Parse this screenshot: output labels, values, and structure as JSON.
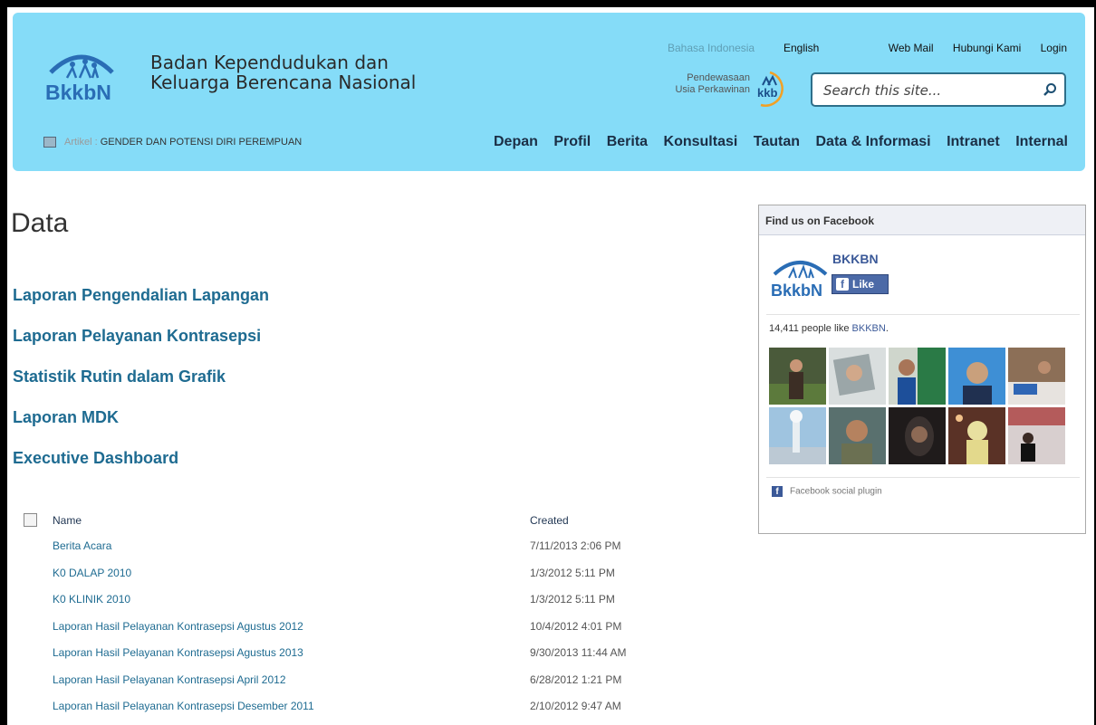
{
  "header": {
    "org_line1": "Badan Kependudukan dan",
    "org_line2": "Keluarga Berencana Nasional",
    "lang_id": "Bahasa Indonesia",
    "lang_en": "English",
    "top_links": [
      "Web Mail",
      "Hubungi Kami",
      "Login"
    ],
    "pendewasaan_line1": "Pendewasaan",
    "pendewasaan_line2": "Usia Perkawinan",
    "search_placeholder": "Search this site...",
    "article_prefix": "Artikel :",
    "article_title": "GENDER DAN POTENSI DIRI PEREMPUAN",
    "nav": [
      "Depan",
      "Profil",
      "Berita",
      "Konsultasi",
      "Tautan",
      "Data & Informasi",
      "Intranet",
      "Internal"
    ]
  },
  "main": {
    "title": "Data",
    "section_links": [
      "Laporan Pengendalian Lapangan",
      "Laporan Pelayanan Kontrasepsi",
      "Statistik Rutin dalam Grafik",
      "Laporan MDK",
      "Executive Dashboard"
    ],
    "list": {
      "col_name": "Name",
      "col_created": "Created",
      "rows": [
        {
          "name": "Berita Acara",
          "created": "7/11/2013 2:06 PM"
        },
        {
          "name": "K0 DALAP 2010",
          "created": "1/3/2012 5:11 PM"
        },
        {
          "name": "K0 KLINIK 2010",
          "created": "1/3/2012 5:11 PM"
        },
        {
          "name": "Laporan Hasil Pelayanan Kontrasepsi Agustus 2012",
          "created": "10/4/2012 4:01 PM"
        },
        {
          "name": "Laporan Hasil Pelayanan Kontrasepsi Agustus 2013",
          "created": "9/30/2013 11:44 AM"
        },
        {
          "name": "Laporan Hasil Pelayanan Kontrasepsi April 2012",
          "created": "6/28/2012 1:21 PM"
        },
        {
          "name": "Laporan Hasil Pelayanan Kontrasepsi Desember 2011",
          "created": "2/10/2012 9:47 AM"
        }
      ]
    }
  },
  "facebook": {
    "header": "Find us on Facebook",
    "page_name": "BKKBN",
    "like_label": "Like",
    "count_text": "14,411 people like ",
    "count_link": "BKKBN",
    "count_suffix": ".",
    "plugin_text": "Facebook social plugin"
  },
  "logo_text": "BkkbN",
  "kkb_text": "kkb",
  "colors": {
    "header_bg": "#85dcf8",
    "link": "#1e6b91",
    "nav_text": "#1b2e45",
    "facebook_blue": "#3b5998"
  }
}
